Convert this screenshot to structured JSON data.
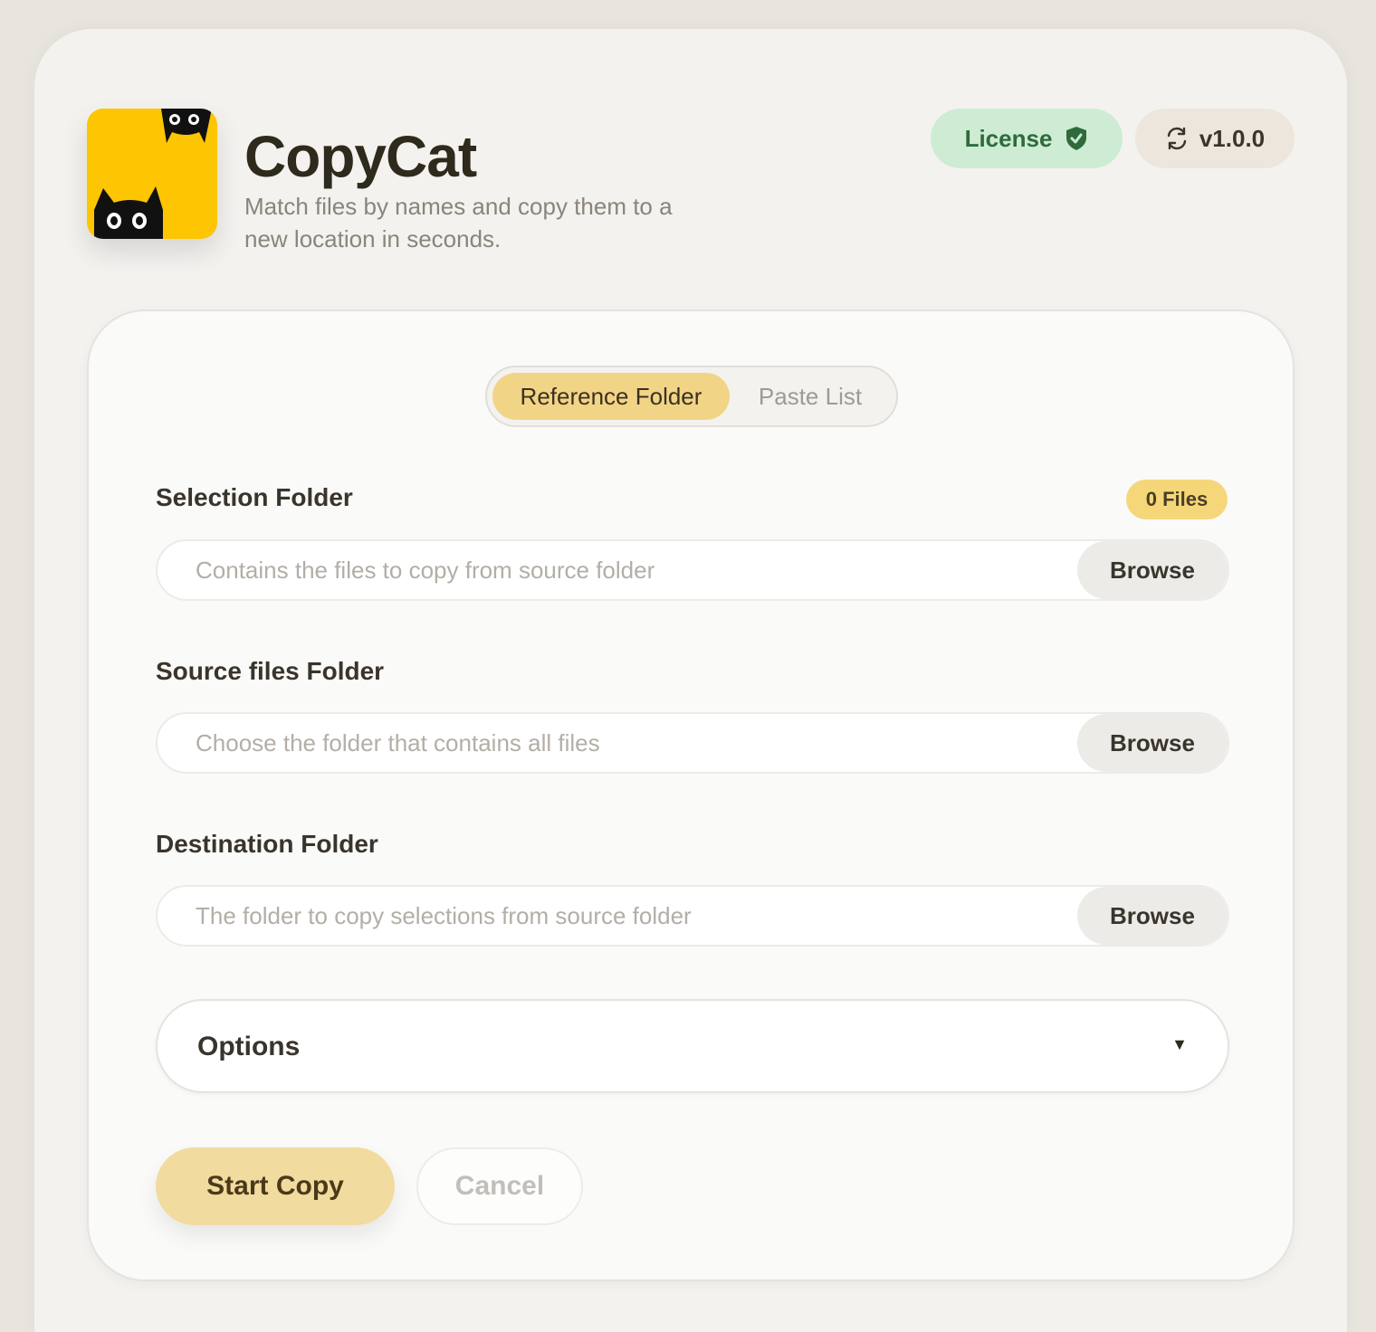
{
  "app": {
    "title": "CopyCat",
    "subtitle": "Match files by names and copy them to a new location in seconds."
  },
  "header": {
    "license_label": "License",
    "license_icon": "shield-check-icon",
    "version_label": "v1.0.0",
    "version_icon": "refresh-icon"
  },
  "tabs": [
    {
      "label": "Reference Folder",
      "active": true
    },
    {
      "label": "Paste List",
      "active": false
    }
  ],
  "selection": {
    "label": "Selection Folder",
    "badge": "0 Files",
    "placeholder": "Contains the files to copy from source folder",
    "value": "",
    "browse_label": "Browse"
  },
  "source": {
    "label": "Source files Folder",
    "placeholder": "Choose the folder that contains all files",
    "value": "",
    "browse_label": "Browse"
  },
  "destination": {
    "label": "Destination Folder",
    "placeholder": "The folder to copy selections from source folder",
    "value": "",
    "browse_label": "Browse"
  },
  "options": {
    "label": "Options",
    "arrow": "▼"
  },
  "actions": {
    "start_label": "Start Copy",
    "cancel_label": "Cancel"
  },
  "colors": {
    "accent": "#f2d487",
    "icon_yellow": "#fec502",
    "license_bg": "#cdecd3",
    "license_text": "#2f6a3c"
  }
}
